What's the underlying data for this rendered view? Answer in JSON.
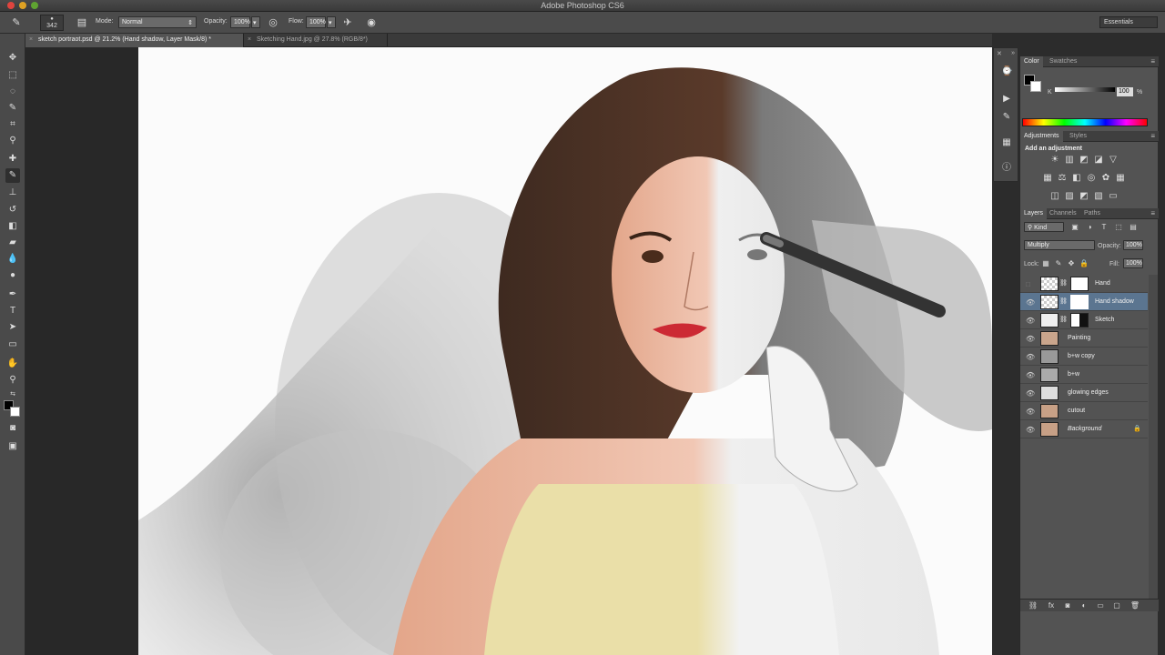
{
  "window": {
    "title": "Adobe Photoshop CS6"
  },
  "options_bar": {
    "brush_size": "342",
    "mode_label": "Mode:",
    "mode_value": "Normal",
    "opacity_label": "Opacity:",
    "opacity_value": "100%",
    "flow_label": "Flow:",
    "flow_value": "100%",
    "workspace": "Essentials"
  },
  "doc_tabs": [
    {
      "label": "sketch portraot.psd @ 21.2% (Hand shadow, Layer Mask/8) *"
    },
    {
      "label": "Sketching Hand.jpg @ 27.8% (RGB/8*)"
    }
  ],
  "color_panel": {
    "tabs": [
      "Color",
      "Swatches"
    ],
    "channel": "K",
    "value": "100",
    "unit": "%"
  },
  "adjustments_panel": {
    "tabs": [
      "Adjustments",
      "Styles"
    ],
    "heading": "Add an adjustment"
  },
  "layers_panel": {
    "tabs": [
      "Layers",
      "Channels",
      "Paths"
    ],
    "kind": "Kind",
    "blend_mode": "Multiply",
    "opacity_label": "Opacity:",
    "opacity_value": "100%",
    "lock_label": "Lock:",
    "fill_label": "Fill:",
    "fill_value": "100%",
    "layers": [
      {
        "name": "Hand"
      },
      {
        "name": "Hand shadow"
      },
      {
        "name": "Sketch"
      },
      {
        "name": "Painting"
      },
      {
        "name": "b+w copy"
      },
      {
        "name": "b+w"
      },
      {
        "name": "glowing edges"
      },
      {
        "name": "cutout"
      },
      {
        "name": "Background"
      }
    ]
  },
  "colors": {
    "accent_selected": "#5b7590",
    "lips": "#cc2a34",
    "hair": "#5a3a2a",
    "dress": "#e8dba0"
  },
  "icons": [
    "brush-icon",
    "move-icon",
    "marquee-icon",
    "lasso-icon",
    "crop-icon",
    "eyedropper-icon",
    "healing-icon",
    "stamp-icon",
    "eraser-icon",
    "gradient-icon",
    "pen-icon",
    "type-icon",
    "hand-icon",
    "zoom-icon",
    "eye-icon",
    "lock-icon",
    "link-icon"
  ]
}
